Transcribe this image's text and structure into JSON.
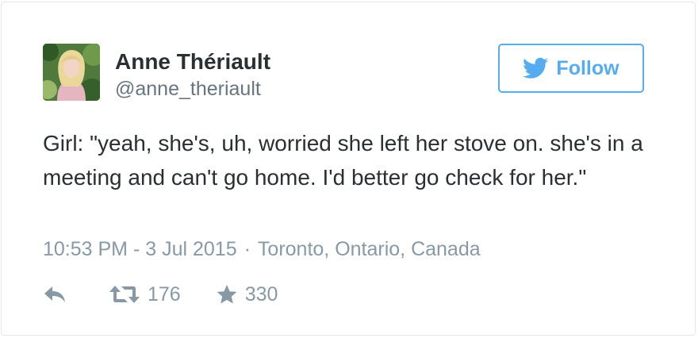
{
  "tweet": {
    "author": {
      "name": "Anne Thériault",
      "handle": "@anne_theriault",
      "avatar_icon": "profile-photo"
    },
    "follow_button": {
      "label": "Follow",
      "icon": "twitter-bird-icon",
      "color": "#55acee"
    },
    "text": "Girl: \"yeah, she's, uh, worried she left her stove on. she's in a meeting and can't go home. I'd better go check for her.\"",
    "timestamp": "10:53 PM - 3 Jul 2015",
    "separator": "·",
    "location": "Toronto, Ontario, Canada",
    "actions": {
      "reply_icon": "reply-icon",
      "retweet_icon": "retweet-icon",
      "retweet_count": "176",
      "favorite_icon": "star-icon",
      "favorite_count": "330"
    }
  },
  "colors": {
    "text_primary": "#292f33",
    "text_secondary": "#66757f",
    "meta": "#8899a6",
    "accent": "#55acee",
    "border": "#e1e8ed"
  }
}
